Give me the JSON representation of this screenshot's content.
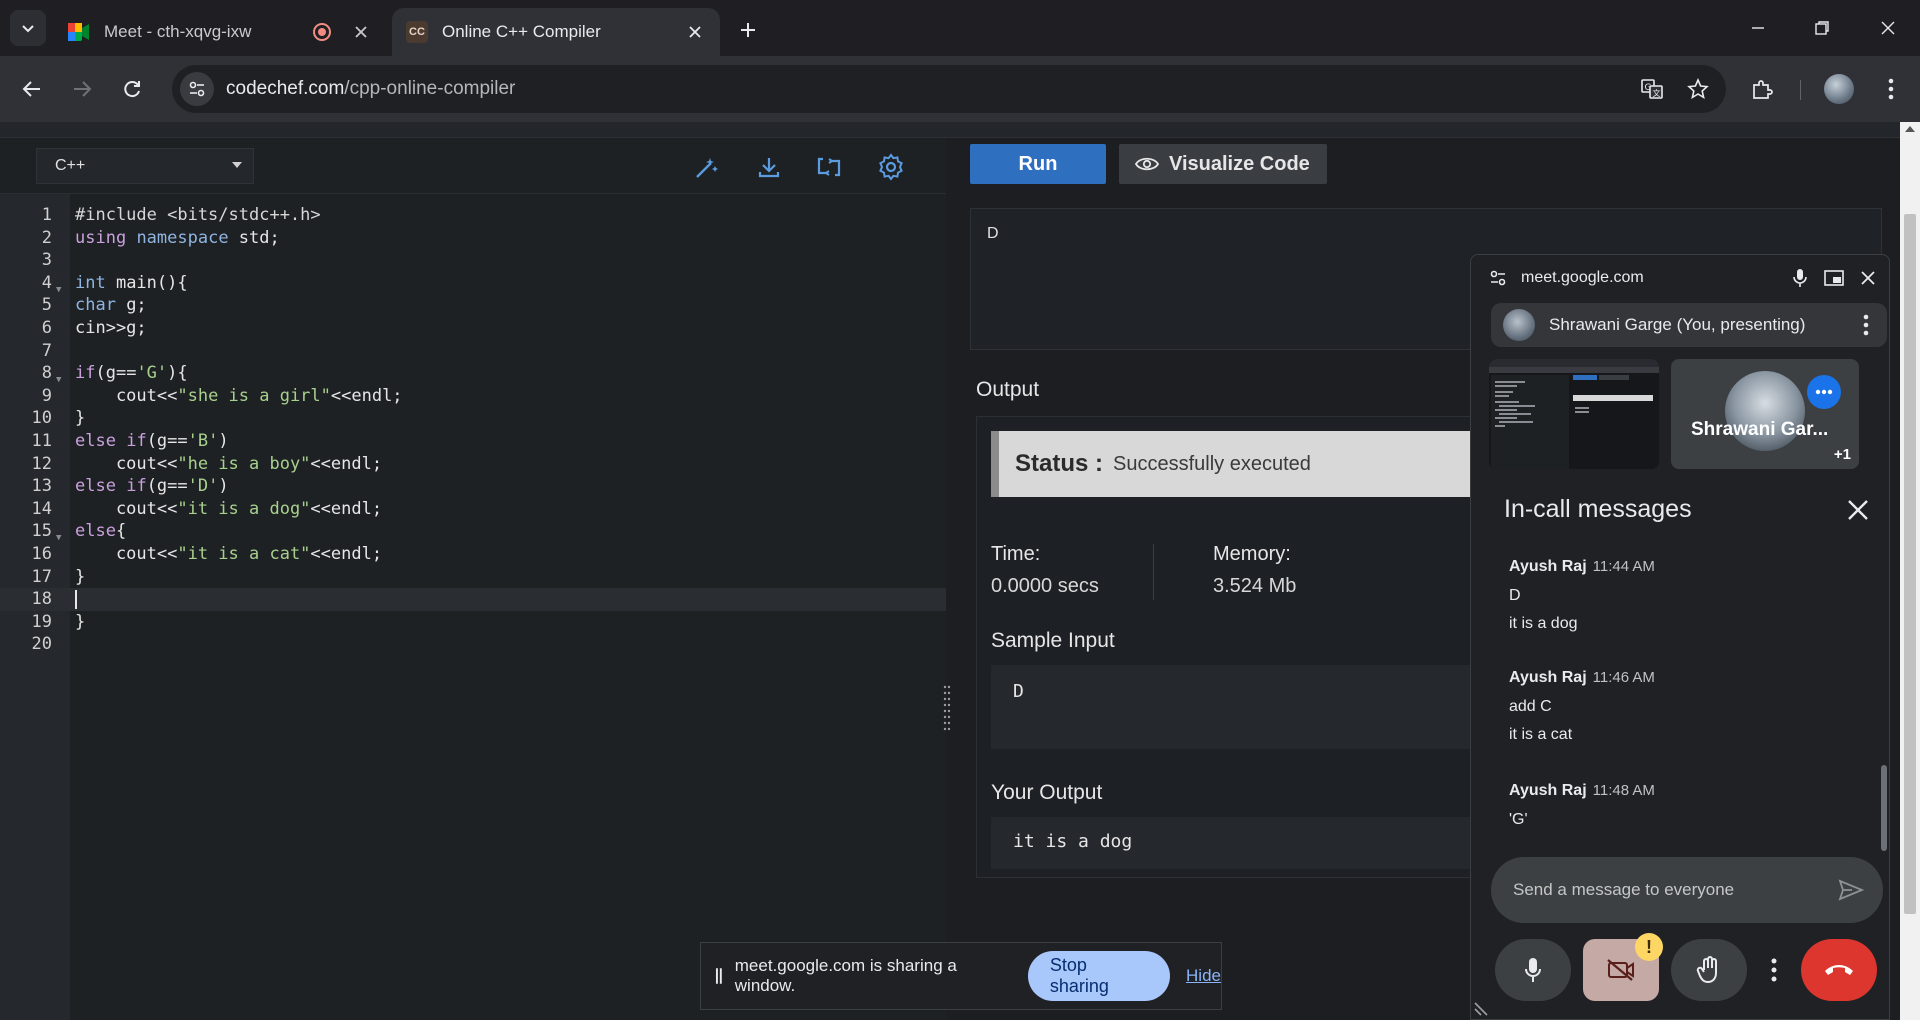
{
  "tabs": [
    {
      "title": "Meet - cth-xqvg-ixw",
      "favicon": "google-meet-icon",
      "recording": true
    },
    {
      "title": "Online C++ Compiler",
      "favicon": "codechef-icon",
      "favicon_text": "CC",
      "active": true
    }
  ],
  "address_bar": {
    "host": "codechef.com",
    "path": "/cpp-online-compiler"
  },
  "editor": {
    "language": "C++",
    "tools": [
      "magic-wand-icon",
      "download-icon",
      "fullscreen-icon",
      "settings-icon"
    ],
    "active_line": 18
  },
  "run": {
    "run_label": "Run",
    "visualize_label": "Visualize Code"
  },
  "custom_input": "D",
  "output": {
    "heading": "Output",
    "status_label": "Status :",
    "status_value": "Successfully executed",
    "time_label": "Time:",
    "time_value": "0.0000 secs",
    "memory_label": "Memory:",
    "memory_value": "3.524 Mb",
    "sample_input_label": "Sample Input",
    "sample_input_value": "D",
    "your_output_label": "Your Output",
    "your_output_value": "it is a dog"
  },
  "sharing_bar": {
    "text": "meet.google.com is sharing a window.",
    "stop_label": "Stop sharing",
    "hide_label": "Hide"
  },
  "meet_pip": {
    "domain": "meet.google.com",
    "presenter": "Shrawani Garge (You, presenting)",
    "participant_name": "Shrawani Gar...",
    "participant_extra": "+1",
    "messages_title": "In-call messages",
    "messages": [
      {
        "sender": "Ayush Raj",
        "time": "11:44 AM",
        "lines": [
          "D",
          "it is a dog"
        ]
      },
      {
        "sender": "Ayush Raj",
        "time": "11:46 AM",
        "lines": [
          "add C",
          "it is a cat"
        ]
      },
      {
        "sender": "Ayush Raj",
        "time": "11:48 AM",
        "lines": [
          "'G'"
        ]
      }
    ],
    "input_placeholder": "Send a message to everyone",
    "camera_warning": "!"
  },
  "colors": {
    "run_button": "#2f6fbf",
    "end_call": "#dc362e",
    "stop_sharing": "#a8c7fa",
    "accent_blue": "#1a73e8"
  }
}
